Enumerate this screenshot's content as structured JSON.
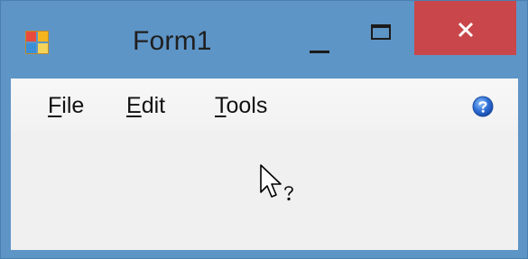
{
  "window": {
    "title": "Form1",
    "close_glyph": "×",
    "colors": {
      "frame": "#5e95c7",
      "close_button": "#c9464a",
      "client": "#f0f0f0"
    }
  },
  "menu": {
    "items": [
      {
        "mnemonic": "F",
        "rest": "ile"
      },
      {
        "mnemonic": "E",
        "rest": "dit"
      },
      {
        "mnemonic": "T",
        "rest": "ools"
      }
    ],
    "help_icon": "help-icon"
  },
  "cursor": {
    "icon": "help-select-cursor-icon"
  },
  "icons": {
    "app": "windows-forms-app-icon",
    "minimize": "minimize-icon",
    "maximize": "maximize-icon",
    "close": "close-icon"
  }
}
